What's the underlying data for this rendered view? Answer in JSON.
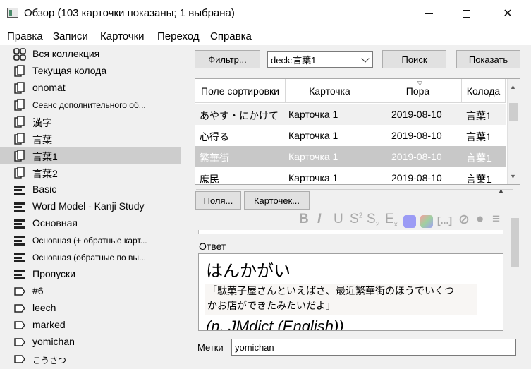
{
  "window": {
    "title": "Обзор (103 карточки показаны; 1 выбрана)"
  },
  "menu": [
    "Правка",
    "Записи",
    "Карточки",
    "Переход",
    "Справка"
  ],
  "sidebar": {
    "items": [
      {
        "label": "Вся коллекция",
        "icon": "collection-icon",
        "small": false,
        "selected": false
      },
      {
        "label": "Текущая колода",
        "icon": "deck-icon",
        "small": false,
        "selected": false
      },
      {
        "label": "onomat",
        "icon": "deck-icon",
        "small": false,
        "selected": false
      },
      {
        "label": "Сеанс дополнительного об...",
        "icon": "deck-icon",
        "small": true,
        "selected": false
      },
      {
        "label": "漢字",
        "icon": "deck-icon",
        "small": false,
        "selected": false
      },
      {
        "label": "言葉",
        "icon": "deck-icon",
        "small": false,
        "selected": false
      },
      {
        "label": "言葉1",
        "icon": "deck-icon",
        "small": false,
        "selected": true
      },
      {
        "label": "言葉2",
        "icon": "deck-icon",
        "small": false,
        "selected": false
      },
      {
        "label": "Basic",
        "icon": "note-type-icon",
        "small": false,
        "selected": false
      },
      {
        "label": "Word Model - Kanji Study",
        "icon": "note-type-icon",
        "small": false,
        "selected": false
      },
      {
        "label": "Основная",
        "icon": "note-type-icon",
        "small": false,
        "selected": false
      },
      {
        "label": "Основная (+ обратные карт...",
        "icon": "note-type-icon",
        "small": true,
        "selected": false
      },
      {
        "label": "Основная (обратные по вы...",
        "icon": "note-type-icon",
        "small": true,
        "selected": false
      },
      {
        "label": "Пропуски",
        "icon": "note-type-icon",
        "small": false,
        "selected": false
      },
      {
        "label": "#6",
        "icon": "tag-icon",
        "small": false,
        "selected": false
      },
      {
        "label": "leech",
        "icon": "tag-icon",
        "small": false,
        "selected": false
      },
      {
        "label": "marked",
        "icon": "tag-icon",
        "small": false,
        "selected": false
      },
      {
        "label": "yomichan",
        "icon": "tag-icon",
        "small": false,
        "selected": false
      },
      {
        "label": "こうさつ",
        "icon": "tag-icon",
        "small": true,
        "selected": false
      }
    ]
  },
  "search": {
    "filter_label": "Фильтр...",
    "query": "deck:言葉1",
    "search_label": "Поиск",
    "preview_label": "Показать"
  },
  "table": {
    "headers": [
      "Поле сортировки",
      "Карточка",
      "Пора",
      "Колода"
    ],
    "rows": [
      [
        "あやす・にかけて",
        "Карточка 1",
        "2019-08-10",
        "言葉1"
      ],
      [
        "心得る",
        "Карточка 1",
        "2019-08-10",
        "言葉1"
      ],
      [
        "繁華街",
        "Карточка 1",
        "2019-08-10",
        "言葉1"
      ],
      [
        "庶民",
        "Карточка 1",
        "2019-08-10",
        "言葉1"
      ]
    ],
    "selected_row": 2
  },
  "editor": {
    "fields_button": "Поля...",
    "cards_button": "Карточек...",
    "toolbar_icons": [
      "bold-icon",
      "italic-icon",
      "underline-icon",
      "superscript-icon",
      "subscript-icon",
      "clear-format-icon",
      "text-color-icon",
      "highlight-color-icon",
      "cloze-icon",
      "attach-icon",
      "record-icon",
      "more-icon"
    ],
    "field_label": "Ответ",
    "answer_reading": "はんかがい",
    "answer_quote_line1": "「駄菓子屋さんといえばさ、最近繁華街のほうでいくつ",
    "answer_quote_line2": "かお店ができたみたいだよ」",
    "answer_meaning": "(n, JMdict (English))"
  },
  "tags": {
    "label": "Метки",
    "value": "yomichan"
  },
  "colors": {
    "selection": "#cdcdcd",
    "table_selection": "#c8c8c8"
  }
}
